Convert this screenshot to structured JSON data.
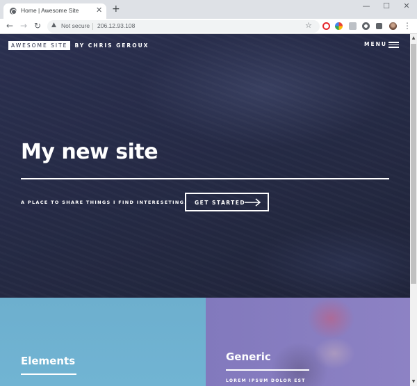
{
  "browser": {
    "tab_title": "Home | Awesome Site",
    "tab_close": "✕",
    "new_tab": "+",
    "window_controls": {
      "minimize": "—",
      "maximize": "☐",
      "close": "✕"
    },
    "back": "←",
    "forward": "→",
    "reload": "↻",
    "security_label": "Not secure",
    "url": "206.12.93.108",
    "menu": "⋮",
    "extensions": [
      {
        "name": "opera-extension-icon",
        "color": "#e5272c"
      },
      {
        "name": "colorful-extension-icon",
        "color": "#4caf50"
      },
      {
        "name": "gray-extension-icon",
        "color": "#9aa0a6"
      },
      {
        "name": "circle-extension-icon",
        "color": "#5f6368"
      },
      {
        "name": "puzzle-extensions-icon",
        "color": "#5f6368"
      },
      {
        "name": "profile-avatar",
        "color": "#6b4a3a"
      }
    ]
  },
  "site": {
    "logo_box": "AWESOME SITE",
    "logo_by": "BY CHRIS GEROUX",
    "menu_label": "MENU",
    "hero_title": "My new site",
    "hero_subtitle": "A PLACE TO SHARE THINGS I FIND INTERESETING.",
    "cta_label": "GET STARTED"
  },
  "tiles": [
    {
      "title": "Elements",
      "subtitle": "",
      "color": "#6fb3d2"
    },
    {
      "title": "Generic",
      "subtitle": "LOREM IPSUM DOLOR EST",
      "color": "#8d82c4"
    }
  ],
  "colors": {
    "banner_bg": "#242943",
    "accent_white": "#ffffff"
  }
}
